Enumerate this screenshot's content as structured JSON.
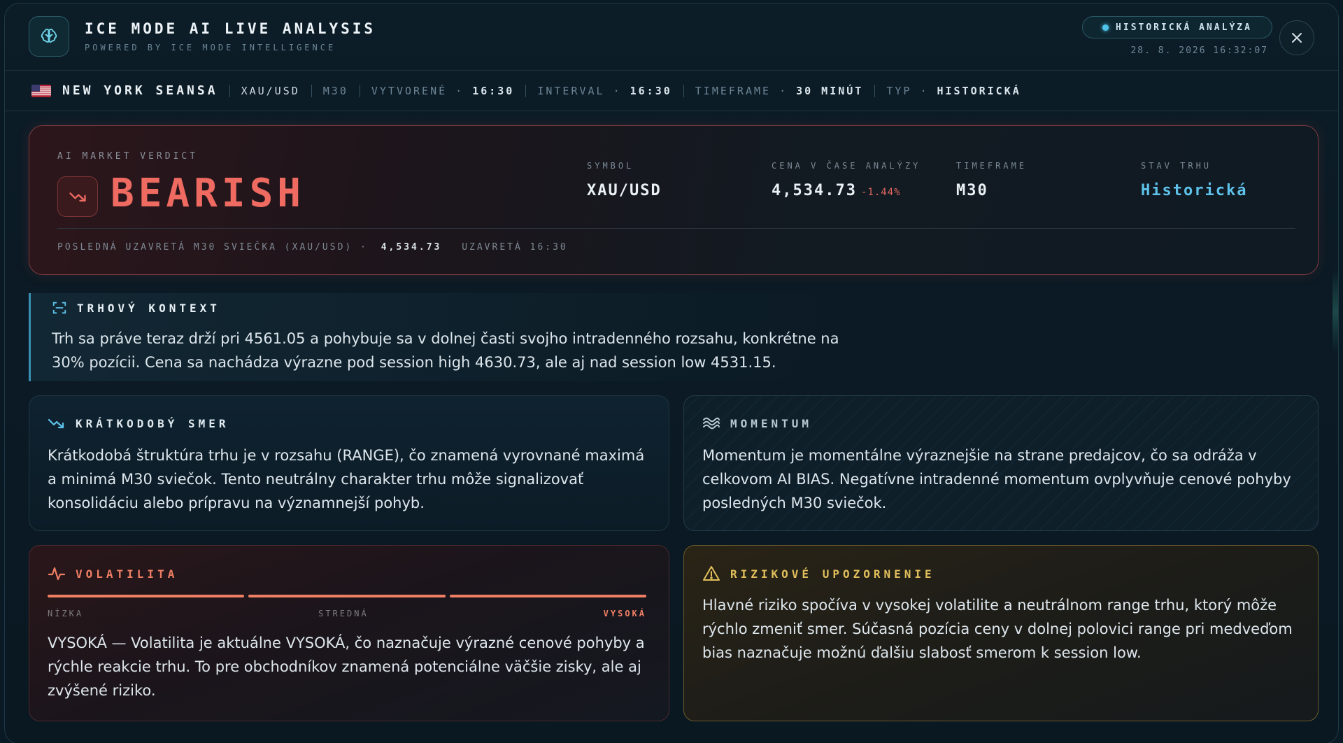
{
  "header": {
    "title": "ICE MODE AI LIVE ANALYSIS",
    "subtitle": "POWERED BY ICE MODE INTELLIGENCE",
    "badge": "HISTORICKÁ ANALÝZA",
    "timestamp": "28. 8. 2026 16:32:07",
    "icons": {
      "logo": "brain-icon",
      "close": "close-icon",
      "badge_dot": "status-dot-icon"
    }
  },
  "infobar": {
    "flag": "us-flag-icon",
    "session": "NEW YORK SEANSA",
    "symbol": "XAU/USD",
    "timeframe_short": "M30",
    "created_label": "VYTVORENÉ",
    "created_value": "16:30",
    "interval_label": "INTERVAL",
    "interval_value": "16:30",
    "timeframe_label": "TIMEFRAME",
    "timeframe_value": "30 MINÚT",
    "type_label": "TYP",
    "type_value": "HISTORICKÁ",
    "dot": "·"
  },
  "verdict": {
    "label": "AI MARKET VERDICT",
    "value": "BEARISH",
    "icon": "trending-down-icon",
    "stats": {
      "symbol_label": "SYMBOL",
      "symbol_value": "XAU/USD",
      "price_label": "CENA V ČASE ANALÝZY",
      "price_value": "4,534.73",
      "price_change": "-1.44%",
      "timeframe_label": "TIMEFRAME",
      "timeframe_value": "M30",
      "state_label": "STAV TRHU",
      "state_value": "Historická"
    },
    "last_candle_text": "POSLEDNÁ UZAVRETÁ M30 SVIEČKA (XAU/USD) ·",
    "last_candle_price": "4,534.73",
    "last_candle_closed": "UZAVRETÁ 16:30"
  },
  "context": {
    "title": "TRHOVÝ KONTEXT",
    "icon": "scan-icon",
    "text": "Trh sa práve teraz drží pri 4561.05 a pohybuje sa v dolnej časti svojho intradenného rozsahu, konkrétne na 30% pozícii. Cena sa nachádza výrazne pod session high 4630.73, ale aj nad session low 4531.15."
  },
  "short_term": {
    "title": "KRÁTKODOBÝ SMER",
    "icon": "trending-down-icon",
    "text": "Krátkodobá štruktúra trhu je v rozsahu (RANGE), čo znamená vyrovnané maximá a minimá M30 sviečok. Tento neutrálny charakter trhu môže signalizovať konsolidáciu alebo prípravu na významnejší pohyb."
  },
  "momentum": {
    "title": "MOMENTUM",
    "icon": "waves-icon",
    "text": "Momentum je momentálne výraznejšie na strane predajcov, čo sa odráža v celkovom AI BIAS. Negatívne intradenné momentum ovplyvňuje cenové pohyby posledných M30 sviečok."
  },
  "volatility": {
    "title": "VOLATILITA",
    "icon": "pulse-icon",
    "level_low": "NÍZKA",
    "level_mid": "STREDNÁ",
    "level_high": "VYSOKÁ",
    "active_level": "VYSOKÁ",
    "text": "VYSOKÁ — Volatilita je aktuálne VYSOKÁ, čo naznačuje výrazné cenové pohyby a rýchle reakcie trhu. To pre obchodníkov znamená potenciálne väčšie zisky, ale aj zvýšené riziko."
  },
  "risk": {
    "title": "RIZIKOVÉ UPOZORNENIE",
    "icon": "warning-triangle-icon",
    "text": "Hlavné riziko spočíva v vysokej volatilite a neutrálnom range trhu, ktorý môže rýchlo zmeniť smer. Súčasná pozícia ceny v dolnej polovici range pri medveďom bias naznačuje možnú ďalšiu slabosť smerom k session low."
  },
  "colors": {
    "bearish": "#ef6a61",
    "accent_blue": "#5ec2ea",
    "volatility": "#ef7f63",
    "risk": "#e2bf5c",
    "momentum": "#b8c7d2"
  }
}
